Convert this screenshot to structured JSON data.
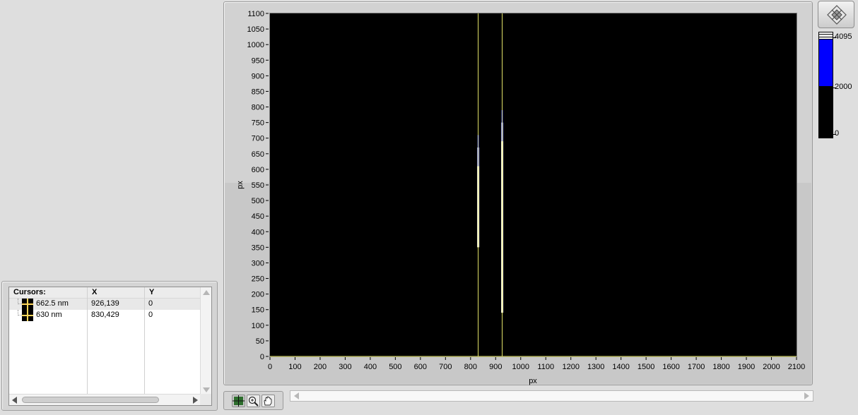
{
  "cursor_legend": {
    "headers": {
      "name": "Cursors:",
      "x": "X",
      "y": "Y"
    },
    "rows": [
      {
        "name": "662.5 nm",
        "x": "926,139",
        "y": "0"
      },
      {
        "name": "630 nm",
        "x": "830,429",
        "y": "0"
      }
    ]
  },
  "graph": {
    "x_axis_label": "px",
    "y_axis_label": "px",
    "x_range": [
      0,
      2100
    ],
    "y_range": [
      0,
      1100
    ],
    "x_ticks": [
      "0",
      "100",
      "200",
      "300",
      "400",
      "500",
      "600",
      "700",
      "800",
      "900",
      "1000",
      "1100",
      "1200",
      "1300",
      "1400",
      "1500",
      "1600",
      "1700",
      "1800",
      "1900",
      "2000",
      "2100"
    ],
    "y_ticks": [
      "0",
      "50",
      "100",
      "150",
      "200",
      "250",
      "300",
      "350",
      "400",
      "450",
      "500",
      "550",
      "600",
      "650",
      "700",
      "750",
      "800",
      "850",
      "900",
      "950",
      "1000",
      "1050",
      "1100"
    ],
    "cursors": [
      {
        "name": "662.5 nm",
        "x": 926.139,
        "y": 0
      },
      {
        "name": "630 nm",
        "x": 830.429,
        "y": 0
      }
    ],
    "cursor_color": "#e8e86a",
    "background_color": "#000000"
  },
  "palette_tools": [
    {
      "icon": "cursor-move-icon",
      "active": true
    },
    {
      "icon": "zoom-icon",
      "active": false
    },
    {
      "icon": "pan-hand-icon",
      "active": false
    }
  ],
  "color_scale": {
    "ticks": [
      {
        "label": "4095",
        "value": 4095
      },
      {
        "label": "2000",
        "value": 2000
      },
      {
        "label": "0",
        "value": 0
      }
    ],
    "colors": {
      "high": "#ffffff",
      "mid": "#0000ff",
      "low": "#000000"
    }
  }
}
